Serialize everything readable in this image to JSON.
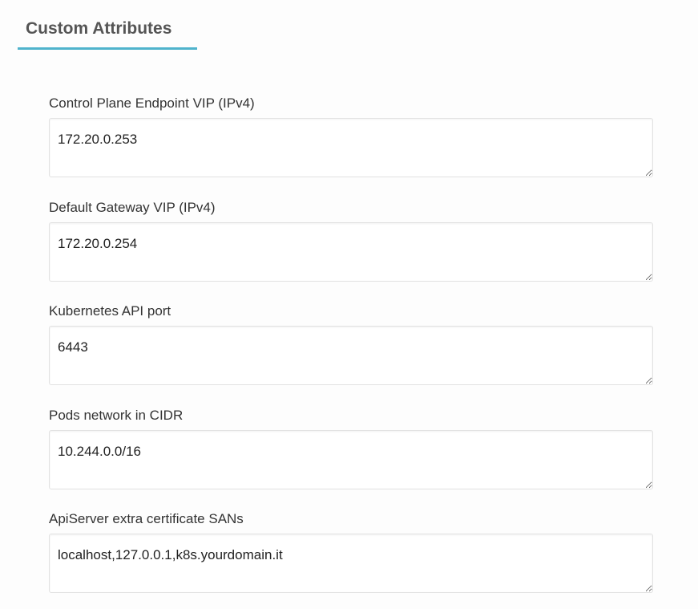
{
  "section": {
    "title": "Custom Attributes",
    "accent_color": "#4fb3cc"
  },
  "fields": [
    {
      "label": "Control Plane Endpoint VIP (IPv4)",
      "value": "172.20.0.253"
    },
    {
      "label": "Default Gateway VIP (IPv4)",
      "value": "172.20.0.254"
    },
    {
      "label": "Kubernetes API port",
      "value": "6443"
    },
    {
      "label": "Pods network in CIDR",
      "value": "10.244.0.0/16"
    },
    {
      "label": "ApiServer extra certificate SANs",
      "value": "localhost,127.0.0.1,k8s.yourdomain.it"
    }
  ]
}
